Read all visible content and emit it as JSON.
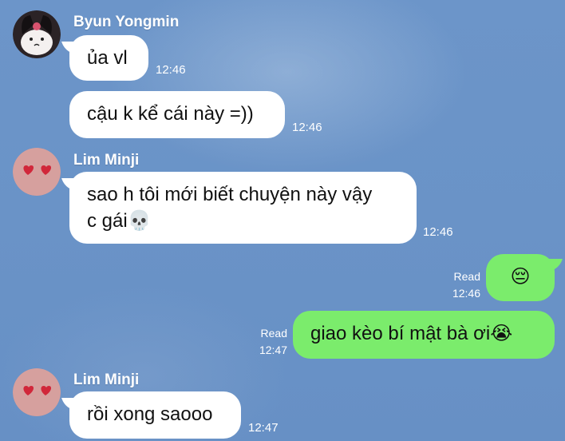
{
  "messages": [
    {
      "sender": "Byun Yongmin",
      "text": "ủa vl",
      "time": "12:46"
    },
    {
      "text": "cậu k kể cái này =))",
      "time": "12:46"
    },
    {
      "sender": "Lim Minji",
      "line1": "sao h tôi mới biết chuyện này vậy",
      "line2": "c gái💀",
      "time": "12:46"
    },
    {
      "text": "😔",
      "status": "Read",
      "time": "12:46"
    },
    {
      "text": "giao kèo bí mật bà ơi😭",
      "status": "Read",
      "time": "12:47"
    },
    {
      "sender": "Lim Minji",
      "text": "rồi xong saooo",
      "time": "12:47"
    }
  ],
  "colors": {
    "background": "#6a93c7",
    "incoming_bubble": "#ffffff",
    "outgoing_bubble": "#7bec6c"
  }
}
